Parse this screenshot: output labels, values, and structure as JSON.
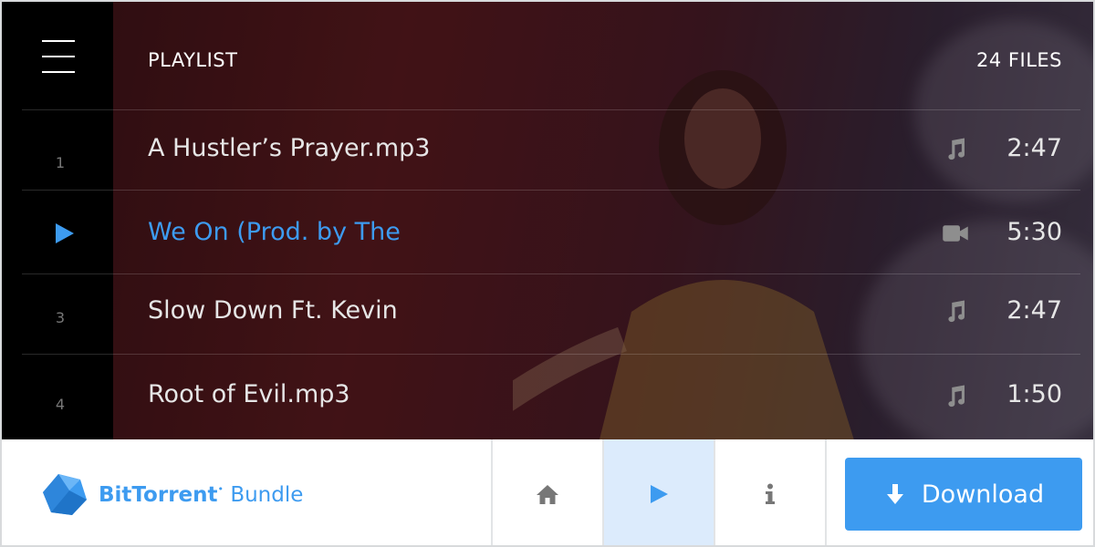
{
  "header": {
    "title": "PLAYLIST",
    "file_count": "24 FILES"
  },
  "playlist": [
    {
      "number": "1",
      "title": "A Hustler’s Prayer.mp3",
      "type_icon": "music-note-icon",
      "duration": "2:47",
      "active": false
    },
    {
      "number": "",
      "title": "We On (Prod. by The",
      "type_icon": "video-camera-icon",
      "duration": "5:30",
      "active": true
    },
    {
      "number": "3",
      "title": "Slow Down Ft. Kevin",
      "type_icon": "music-note-icon",
      "duration": "2:47",
      "active": false
    },
    {
      "number": "4",
      "title": "Root of Evil.mp3",
      "type_icon": "music-note-icon",
      "duration": "1:50",
      "active": false
    }
  ],
  "brand": {
    "name_bold": "BitTorrent",
    "name_regular": "Bundle",
    "logo_icon": "bittorrent-logo-icon"
  },
  "nav": {
    "home_icon": "home-icon",
    "play_icon": "play-icon",
    "info_icon": "info-icon"
  },
  "download": {
    "label": "Download",
    "icon": "arrow-down-icon"
  },
  "colors": {
    "accent": "#3d9bf0",
    "active_tab_bg": "#dcebfc",
    "rail_bg": "#000000"
  }
}
